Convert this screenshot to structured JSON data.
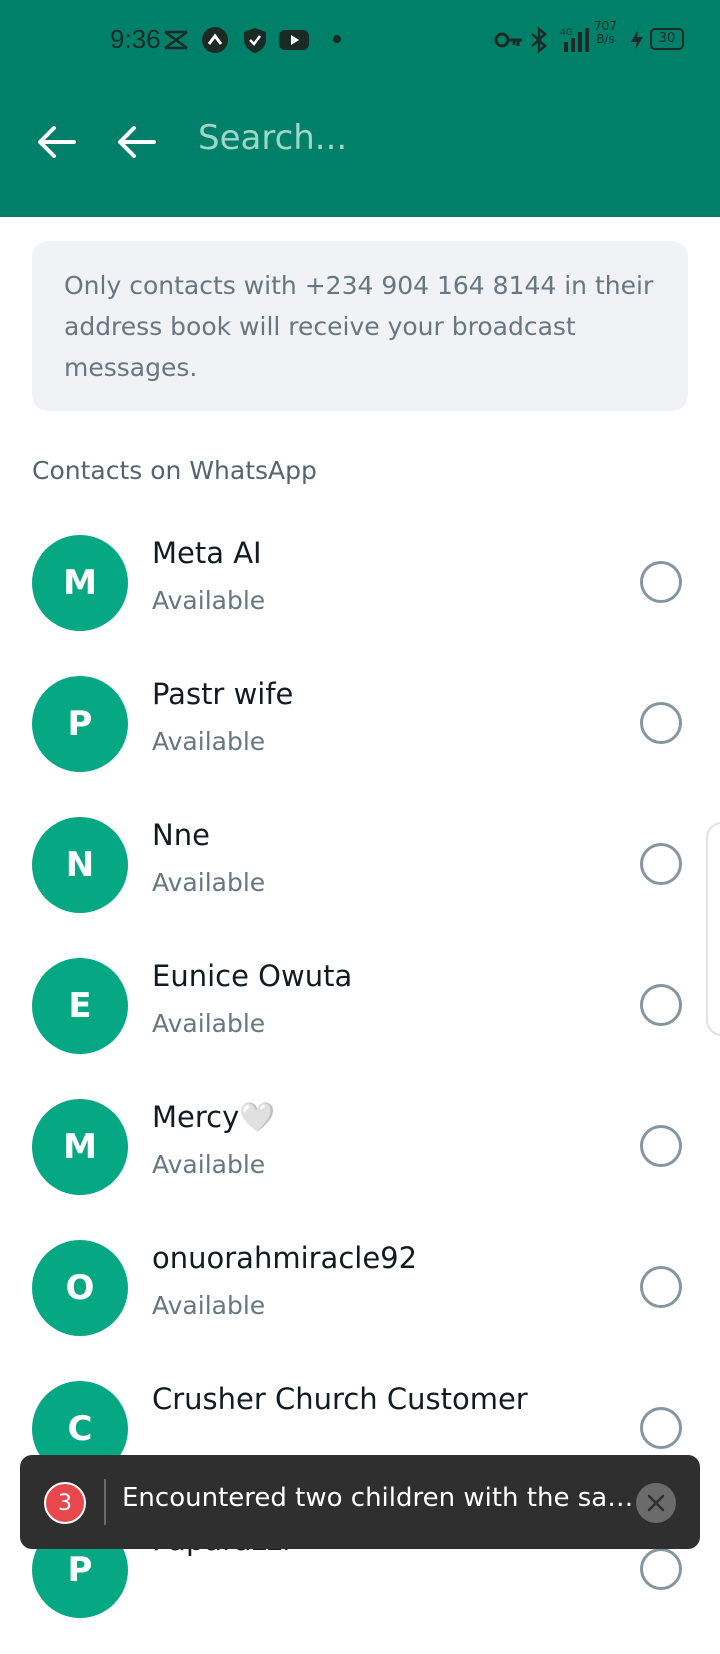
{
  "status_bar": {
    "time": "9:36",
    "network": "4G",
    "speed_value": "707",
    "speed_unit": "B/s",
    "battery": "30"
  },
  "header": {
    "search_placeholder": "Search..."
  },
  "notice": {
    "text": "Only contacts with +234 904 164 8144 in their address book will receive your broadcast messages."
  },
  "section_title": "Contacts on WhatsApp",
  "contacts": [
    {
      "initial": "M",
      "name": "Meta AI",
      "status": "Available"
    },
    {
      "initial": "P",
      "name": "Pastr wife",
      "status": "Available"
    },
    {
      "initial": "N",
      "name": "Nne",
      "status": "Available"
    },
    {
      "initial": "E",
      "name": "Eunice Owuta",
      "status": "Available"
    },
    {
      "initial": "M",
      "name": "Mercy🤍",
      "status": "Available"
    },
    {
      "initial": "O",
      "name": "onuorahmiracle92",
      "status": "Available"
    },
    {
      "initial": "C",
      "name": "Crusher Church Customer",
      "status": ""
    },
    {
      "initial": "P",
      "name": "Paparazzi",
      "status": ""
    }
  ],
  "toast": {
    "count": "3",
    "message": "Encountered two children with the same..."
  },
  "colors": {
    "header": "#008069",
    "avatar": "#06a884",
    "toast_bg": "#2f2f2f",
    "badge": "#e8474c"
  }
}
